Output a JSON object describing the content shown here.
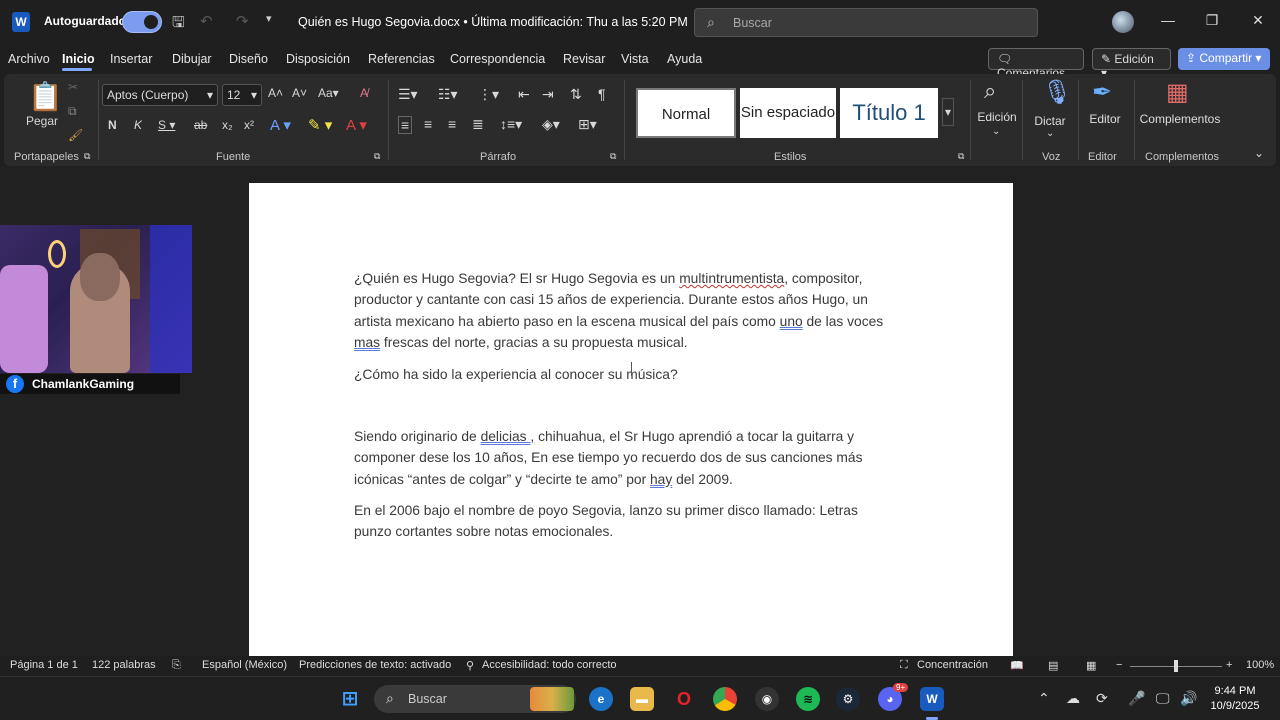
{
  "titlebar": {
    "autosave_label": "Autoguardado",
    "doc_title": "Quién es Hugo Segovia.docx • Última modificación: Thu a las 5:20 PM",
    "search_placeholder": "Buscar"
  },
  "menu": {
    "tabs": [
      "Archivo",
      "Inicio",
      "Insertar",
      "Dibujar",
      "Diseño",
      "Disposición",
      "Referencias",
      "Correspondencia",
      "Revisar",
      "Vista",
      "Ayuda"
    ],
    "active_tab": "Inicio",
    "comments_label": "Comentarios",
    "edit_label": "Edición",
    "share_label": "Compartir"
  },
  "ribbon": {
    "paste_label": "Pegar",
    "font_name": "Aptos (Cuerpo)",
    "font_size": "12",
    "styles": [
      "Normal",
      "Sin espaciado",
      "Título 1"
    ],
    "big_buttons": [
      "Edición",
      "Dictar",
      "Editor",
      "Complementos"
    ],
    "groups": [
      "Portapapeles",
      "Fuente",
      "Párrafo",
      "Estilos",
      "Voz",
      "Editor",
      "Complementos"
    ]
  },
  "document": {
    "p1_a": "¿Quién es Hugo Segovia? El sr Hugo Segovia es un ",
    "p1_spell": "multintrumentista",
    "p1_b": ", compositor, productor y cantante con casi 15 años de experiencia. Durante estos años Hugo, un artista mexicano ha abierto paso en la escena musical del país como ",
    "p1_gram1": "uno",
    "p1_c": " de las voces ",
    "p1_gram2": "mas",
    "p1_d": " frescas del norte, gracias a su propuesta musical.",
    "p2": "¿Cómo ha sido la experiencia al conocer su música?",
    "p3_a": "Siendo originario de ",
    "p3_gram1": "delicias ,",
    "p3_b": " chihuahua, el Sr Hugo aprendió a tocar la guitarra y componer dese los 10 años, En ese tiempo yo recuerdo dos de sus canciones más icónicas “antes de colgar” y “decirte te amo” por ",
    "p3_gram2": "hay",
    "p3_c": " del 2009.",
    "p4": "En el 2006 bajo el nombre de poyo Segovia, lanzo su primer disco llamado: Letras punzo cortantes sobre notas emocionales."
  },
  "overlay": {
    "streamer_name": "ChamlankGaming"
  },
  "statusbar": {
    "page": "Página 1 de 1",
    "words": "122 palabras",
    "language": "Español (México)",
    "predictions": "Predicciones de texto: activado",
    "accessibility": "Accesibilidad: todo correcto",
    "focus": "Concentración",
    "zoom": "100%"
  },
  "taskbar": {
    "search_placeholder": "Buscar",
    "time": "9:44 PM",
    "date": "10/9/2025",
    "discord_badge": "9+"
  }
}
